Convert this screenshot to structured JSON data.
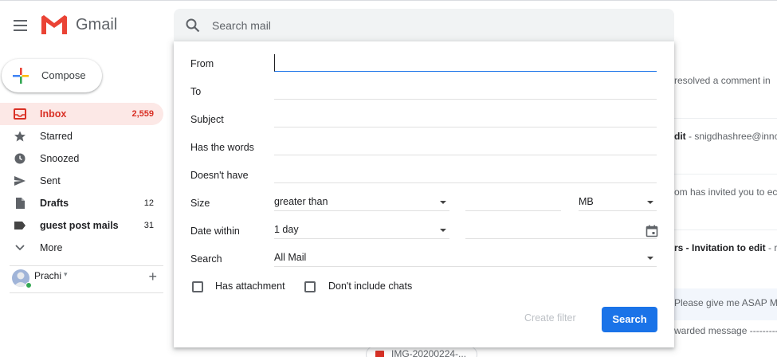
{
  "app": {
    "brand": "Gmail"
  },
  "search": {
    "placeholder": "Search mail"
  },
  "compose": {
    "label": "Compose"
  },
  "sidebar": {
    "items": [
      {
        "label": "Inbox",
        "count": "2,559"
      },
      {
        "label": "Starred",
        "count": ""
      },
      {
        "label": "Snoozed",
        "count": ""
      },
      {
        "label": "Sent",
        "count": ""
      },
      {
        "label": "Drafts",
        "count": "12"
      },
      {
        "label": "guest post mails",
        "count": "31"
      },
      {
        "label": "More",
        "count": ""
      }
    ]
  },
  "hangouts": {
    "user": "Prachi"
  },
  "advanced": {
    "labels": {
      "from": "From",
      "to": "To",
      "subject": "Subject",
      "has_words": "Has the words",
      "doesnt_have": "Doesn't have",
      "size": "Size",
      "date_within": "Date within",
      "search": "Search"
    },
    "size_operator": "greater than",
    "size_unit": "MB",
    "date_within_value": "1 day",
    "search_in": "All Mail",
    "checkbox_has_attachment": "Has attachment",
    "checkbox_no_chats": "Don't include chats",
    "create_filter": "Create filter",
    "search_button": "Search"
  },
  "background_snippets": {
    "s1": "resolved a comment in",
    "s2_bold": "dit",
    "s2": " - snigdhashree@innc",
    "s3": "om has invited you to ec",
    "s4_bold": "rs - Invitation to edit",
    "s4": " - r",
    "s5": "Please give me ASAP M",
    "s6": "warded message ---------",
    "attachment": "IMG-20200224-..."
  },
  "colors": {
    "accent": "#1a73e8",
    "inbox_red": "#d93025",
    "inbox_bg": "#fce8e6"
  },
  "icons": [
    "menu-icon",
    "gmail-logo",
    "search-icon",
    "compose-plus-icon",
    "inbox-icon",
    "star-icon",
    "clock-icon",
    "send-icon",
    "draft-icon",
    "label-icon",
    "chevron-down-icon",
    "calendar-icon",
    "plus-icon"
  ]
}
